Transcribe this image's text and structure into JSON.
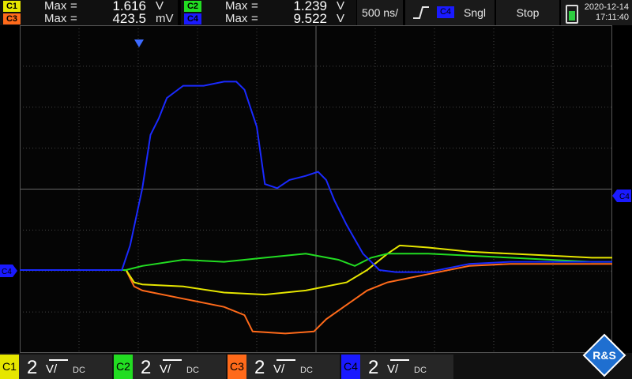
{
  "measurements": [
    {
      "channel": "C1",
      "label": "Max",
      "value": "1.616",
      "unit": "V",
      "color": "#e6e600"
    },
    {
      "channel": "C2",
      "label": "Max",
      "value": "1.239",
      "unit": "V",
      "color": "#22dd22"
    },
    {
      "channel": "C3",
      "label": "Max",
      "value": "423.5",
      "unit": "mV",
      "color": "#ff6a1a"
    },
    {
      "channel": "C4",
      "label": "Max",
      "value": "9.522",
      "unit": "V",
      "color": "#1a1aff"
    }
  ],
  "timebase": "500 ns/",
  "trigger": {
    "channel": "C4",
    "mode": "Sngl"
  },
  "acquisition": "Stop",
  "date": "2020-12-14",
  "time": "17:11:40",
  "bottom_channels": [
    {
      "channel": "C1",
      "scale": "2",
      "unit": "V/",
      "coupling": "DC",
      "color": "#e6e600"
    },
    {
      "channel": "C2",
      "scale": "2",
      "unit": "V/",
      "coupling": "DC",
      "color": "#22dd22"
    },
    {
      "channel": "C3",
      "scale": "2",
      "unit": "V/",
      "coupling": "DC",
      "color": "#ff6a1a"
    },
    {
      "channel": "C4",
      "scale": "2",
      "unit": "V/",
      "coupling": "DC",
      "color": "#1a1aff"
    }
  ],
  "markers": {
    "ch4_ground": "C4",
    "trigger_level": "C4"
  },
  "logo": {
    "text": "R&S"
  },
  "waveforms": {
    "C1": [
      [
        0,
        0
      ],
      [
        2.6,
        0
      ],
      [
        2.8,
        -0.3
      ],
      [
        3,
        -0.35
      ],
      [
        4,
        -0.4
      ],
      [
        5,
        -0.55
      ],
      [
        6,
        -0.6
      ],
      [
        7,
        -0.5
      ],
      [
        8,
        -0.3
      ],
      [
        8.5,
        0
      ],
      [
        9,
        0.4
      ],
      [
        9.3,
        0.6
      ],
      [
        10,
        0.55
      ],
      [
        11,
        0.45
      ],
      [
        12,
        0.4
      ],
      [
        13,
        0.35
      ],
      [
        14,
        0.3
      ],
      [
        14.5,
        0.3
      ]
    ],
    "C2": [
      [
        0,
        0
      ],
      [
        2.6,
        0
      ],
      [
        2.8,
        0.05
      ],
      [
        3,
        0.1
      ],
      [
        4,
        0.25
      ],
      [
        5,
        0.2
      ],
      [
        6,
        0.3
      ],
      [
        7,
        0.4
      ],
      [
        7.8,
        0.25
      ],
      [
        8.2,
        0.1
      ],
      [
        8.6,
        0.3
      ],
      [
        9,
        0.4
      ],
      [
        10,
        0.4
      ],
      [
        11,
        0.35
      ],
      [
        12,
        0.3
      ],
      [
        13,
        0.25
      ],
      [
        14,
        0.2
      ],
      [
        14.5,
        0.2
      ]
    ],
    "C3": [
      [
        0,
        0
      ],
      [
        2.6,
        0
      ],
      [
        2.8,
        -0.4
      ],
      [
        3,
        -0.5
      ],
      [
        4,
        -0.7
      ],
      [
        5,
        -0.9
      ],
      [
        5.5,
        -1.1
      ],
      [
        5.7,
        -1.5
      ],
      [
        6.5,
        -1.55
      ],
      [
        7.2,
        -1.5
      ],
      [
        7.5,
        -1.2
      ],
      [
        8,
        -0.85
      ],
      [
        8.5,
        -0.5
      ],
      [
        9,
        -0.3
      ],
      [
        9.5,
        -0.2
      ],
      [
        10,
        -0.1
      ],
      [
        11,
        0.1
      ],
      [
        12,
        0.15
      ],
      [
        13,
        0.15
      ],
      [
        14.5,
        0.15
      ]
    ],
    "C4": [
      [
        0,
        0
      ],
      [
        2.5,
        0
      ],
      [
        2.7,
        0.6
      ],
      [
        3,
        2.0
      ],
      [
        3.2,
        3.3
      ],
      [
        3.4,
        3.7
      ],
      [
        3.6,
        4.2
      ],
      [
        4,
        4.5
      ],
      [
        4.5,
        4.5
      ],
      [
        5,
        4.6
      ],
      [
        5.3,
        4.6
      ],
      [
        5.5,
        4.4
      ],
      [
        5.8,
        3.5
      ],
      [
        6,
        2.1
      ],
      [
        6.3,
        2.0
      ],
      [
        6.6,
        2.2
      ],
      [
        7,
        2.3
      ],
      [
        7.3,
        2.4
      ],
      [
        7.5,
        2.2
      ],
      [
        7.7,
        1.7
      ],
      [
        8,
        1.1
      ],
      [
        8.4,
        0.4
      ],
      [
        8.8,
        0
      ],
      [
        9.2,
        -0.05
      ],
      [
        10,
        -0.05
      ],
      [
        11,
        0.15
      ],
      [
        12,
        0.2
      ],
      [
        13,
        0.2
      ],
      [
        14.5,
        0.2
      ]
    ]
  }
}
